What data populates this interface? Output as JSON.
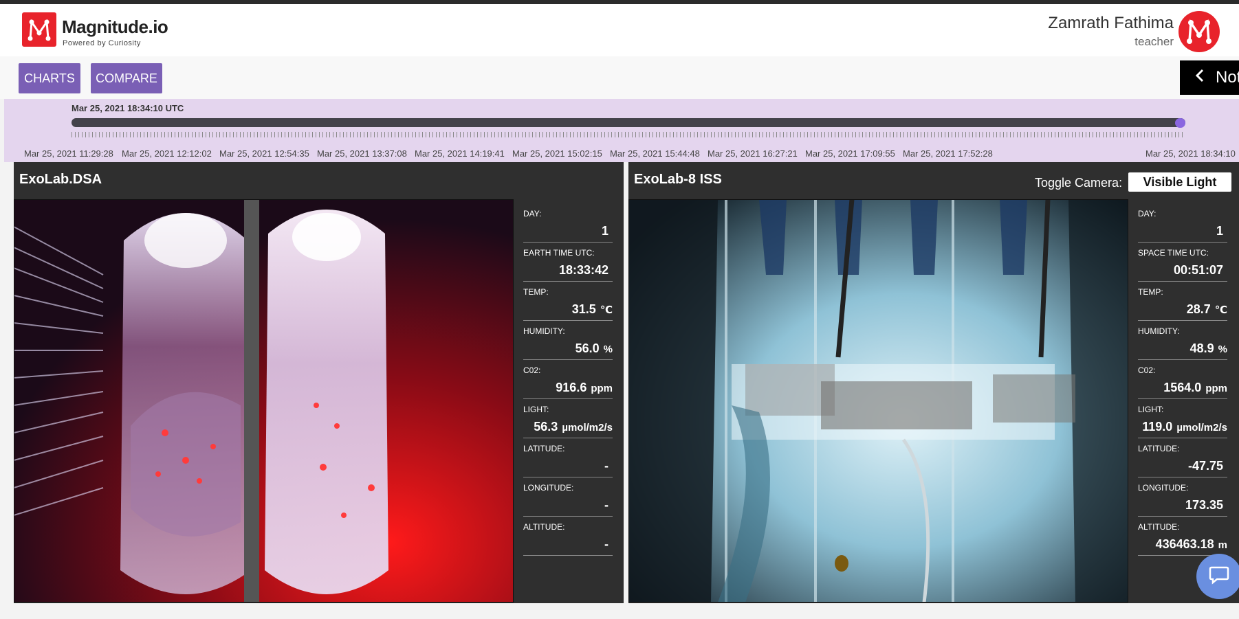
{
  "brand": {
    "name": "Magnitude.io",
    "tagline": "Powered by Curiosity"
  },
  "user": {
    "name": "Zamrath Fathima",
    "role": "teacher"
  },
  "toolbar": {
    "charts_label": "CHARTS",
    "compare_label": "COMPARE",
    "notes_label": "Not"
  },
  "timeline": {
    "current": "Mar 25, 2021 18:34:10 UTC",
    "progress": 1.0,
    "labels": [
      "Mar 25, 2021 11:29:28",
      "Mar 25, 2021 12:12:02",
      "Mar 25, 2021 12:54:35",
      "Mar 25, 2021 13:37:08",
      "Mar 25, 2021 14:19:41",
      "Mar 25, 2021 15:02:15",
      "Mar 25, 2021 15:44:48",
      "Mar 25, 2021 16:27:21",
      "Mar 25, 2021 17:09:55",
      "Mar 25, 2021 17:52:28",
      "Mar 25, 2021 18:34:10"
    ]
  },
  "panels": {
    "left": {
      "title": "ExoLab.DSA",
      "stats": [
        {
          "label": "DAY:",
          "value": "1",
          "unit": ""
        },
        {
          "label": "EARTH TIME UTC:",
          "value": "18:33:42",
          "unit": ""
        },
        {
          "label": "TEMP:",
          "value": "31.5",
          "unit": "℃"
        },
        {
          "label": "HUMIDITY:",
          "value": "56.0",
          "unit": "%"
        },
        {
          "label": "C02:",
          "value": "916.6",
          "unit": "ppm"
        },
        {
          "label": "LIGHT:",
          "value": "56.3",
          "unit": "µmol/m2/s"
        },
        {
          "label": "LATITUDE:",
          "value": "-",
          "unit": ""
        },
        {
          "label": "LONGITUDE:",
          "value": "-",
          "unit": ""
        },
        {
          "label": "ALTITUDE:",
          "value": "-",
          "unit": ""
        }
      ]
    },
    "right": {
      "title": "ExoLab-8 ISS",
      "toggle_label": "Toggle Camera:",
      "toggle_value": "Visible Light",
      "stats": [
        {
          "label": "DAY:",
          "value": "1",
          "unit": ""
        },
        {
          "label": "SPACE TIME UTC:",
          "value": "00:51:07",
          "unit": ""
        },
        {
          "label": "TEMP:",
          "value": "28.7",
          "unit": "℃"
        },
        {
          "label": "HUMIDITY:",
          "value": "48.9",
          "unit": "%"
        },
        {
          "label": "C02:",
          "value": "1564.0",
          "unit": "ppm"
        },
        {
          "label": "LIGHT:",
          "value": "119.0",
          "unit": "µmol/m2/s"
        },
        {
          "label": "LATITUDE:",
          "value": "-47.75",
          "unit": ""
        },
        {
          "label": "LONGITUDE:",
          "value": "173.35",
          "unit": ""
        },
        {
          "label": "ALTITUDE:",
          "value": "436463.18",
          "unit": "m"
        }
      ]
    }
  },
  "icons": {
    "logo": "magnitude-logo",
    "avatar": "magnitude-logo",
    "notes": "chevron-left-icon",
    "chat": "chat-icon"
  },
  "colors": {
    "brand_red": "#e8232b",
    "button_purple": "#7a5fb5",
    "timeline_bg": "#e4d5ee",
    "panel_bg": "#2f2f2f",
    "handle": "#8a66e0"
  }
}
